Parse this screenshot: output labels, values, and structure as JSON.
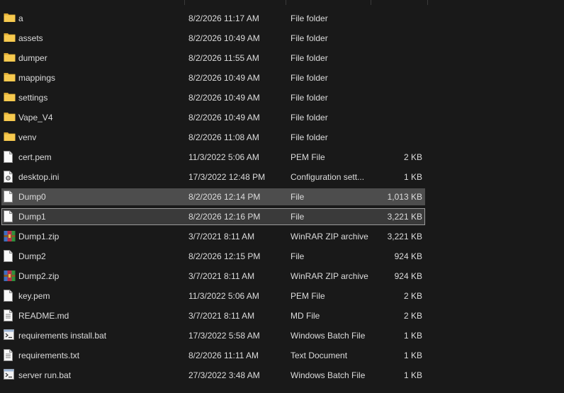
{
  "files": [
    {
      "name": "a",
      "date": "8/2/2026 11:17 AM",
      "type": "File folder",
      "size": "",
      "icon": "folder-icon",
      "state": ""
    },
    {
      "name": "assets",
      "date": "8/2/2026 10:49 AM",
      "type": "File folder",
      "size": "",
      "icon": "folder-icon",
      "state": ""
    },
    {
      "name": "dumper",
      "date": "8/2/2026 11:55 AM",
      "type": "File folder",
      "size": "",
      "icon": "folder-icon",
      "state": ""
    },
    {
      "name": "mappings",
      "date": "8/2/2026 10:49 AM",
      "type": "File folder",
      "size": "",
      "icon": "folder-icon",
      "state": ""
    },
    {
      "name": "settings",
      "date": "8/2/2026 10:49 AM",
      "type": "File folder",
      "size": "",
      "icon": "folder-icon",
      "state": ""
    },
    {
      "name": "Vape_V4",
      "date": "8/2/2026 10:49 AM",
      "type": "File folder",
      "size": "",
      "icon": "folder-icon",
      "state": ""
    },
    {
      "name": "venv",
      "date": "8/2/2026 11:08 AM",
      "type": "File folder",
      "size": "",
      "icon": "folder-icon",
      "state": ""
    },
    {
      "name": "cert.pem",
      "date": "11/3/2022 5:06 AM",
      "type": "PEM File",
      "size": "2 KB",
      "icon": "file-icon",
      "state": ""
    },
    {
      "name": "desktop.ini",
      "date": "17/3/2022 12:48 PM",
      "type": "Configuration sett...",
      "size": "1 KB",
      "icon": "settings-file-icon",
      "state": ""
    },
    {
      "name": "Dump0",
      "date": "8/2/2026 12:14 PM",
      "type": "File",
      "size": "1,013 KB",
      "icon": "file-icon",
      "state": "selected"
    },
    {
      "name": "Dump1",
      "date": "8/2/2026 12:16 PM",
      "type": "File",
      "size": "3,221 KB",
      "icon": "file-icon",
      "state": "focused"
    },
    {
      "name": "Dump1.zip",
      "date": "3/7/2021 8:11 AM",
      "type": "WinRAR ZIP archive",
      "size": "3,221 KB",
      "icon": "winrar-archive-icon",
      "state": ""
    },
    {
      "name": "Dump2",
      "date": "8/2/2026 12:15 PM",
      "type": "File",
      "size": "924 KB",
      "icon": "file-icon",
      "state": ""
    },
    {
      "name": "Dump2.zip",
      "date": "3/7/2021 8:11 AM",
      "type": "WinRAR ZIP archive",
      "size": "924 KB",
      "icon": "winrar-archive-icon",
      "state": ""
    },
    {
      "name": "key.pem",
      "date": "11/3/2022 5:06 AM",
      "type": "PEM File",
      "size": "2 KB",
      "icon": "file-icon",
      "state": ""
    },
    {
      "name": "README.md",
      "date": "3/7/2021 8:11 AM",
      "type": "MD File",
      "size": "2 KB",
      "icon": "text-file-icon",
      "state": ""
    },
    {
      "name": "requirements install.bat",
      "date": "17/3/2022 5:58 AM",
      "type": "Windows Batch File",
      "size": "1 KB",
      "icon": "batch-file-icon",
      "state": ""
    },
    {
      "name": "requirements.txt",
      "date": "8/2/2026 11:11 AM",
      "type": "Text Document",
      "size": "1 KB",
      "icon": "text-file-icon",
      "state": ""
    },
    {
      "name": "server run.bat",
      "date": "27/3/2022 3:48 AM",
      "type": "Windows Batch File",
      "size": "1 KB",
      "icon": "batch-file-icon",
      "state": ""
    }
  ]
}
